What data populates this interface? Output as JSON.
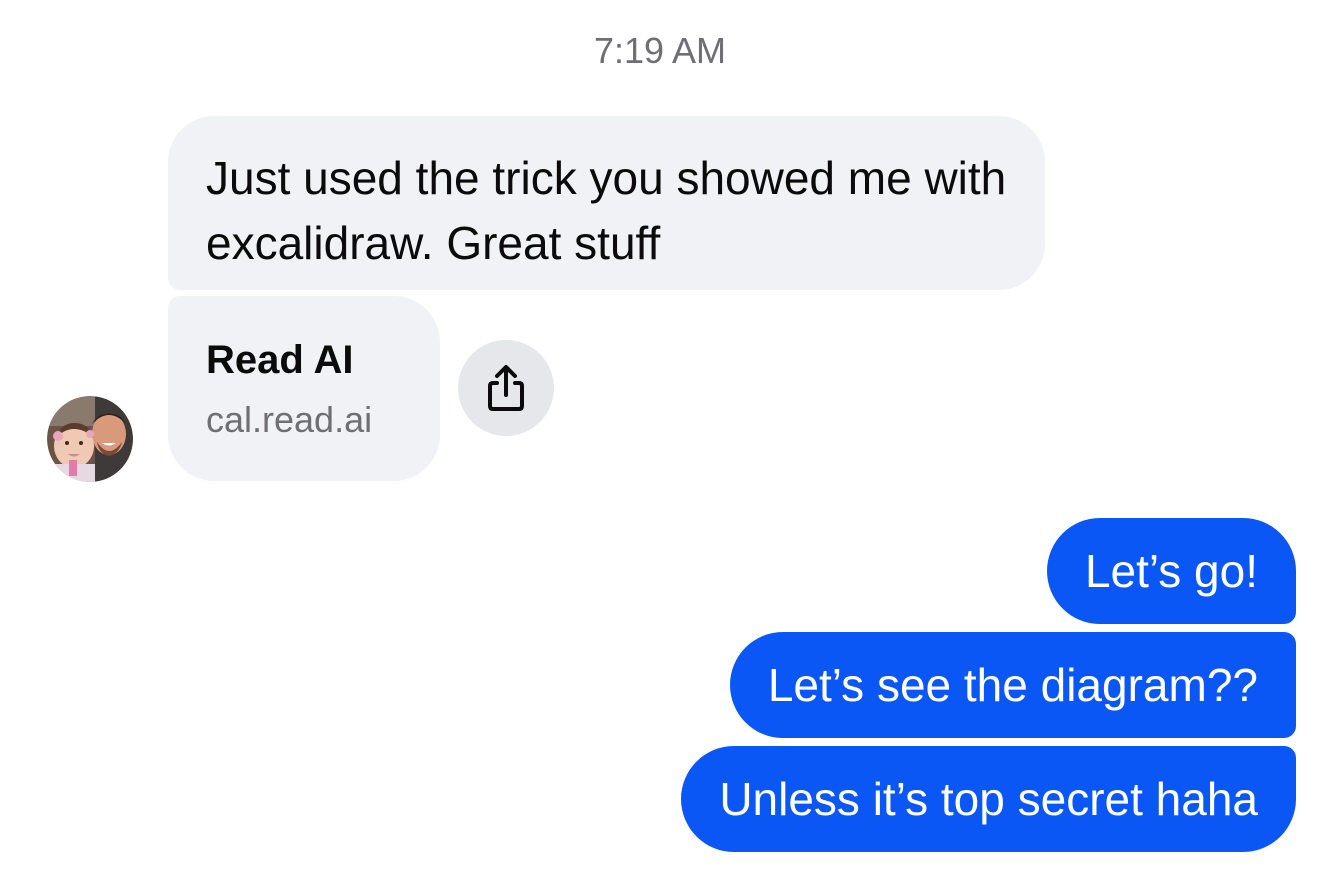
{
  "conversation": {
    "timestamp": "7:19 AM",
    "incoming": {
      "message_1": "Just used the trick you showed me with excalidraw. Great stuff",
      "link_preview": {
        "title": "Read AI",
        "domain": "cal.read.ai"
      },
      "share_icon": "share-icon",
      "avatar": "contact-avatar-photo"
    },
    "outgoing": [
      "Let’s go!",
      "Let’s see the diagram??",
      "Unless it’s top secret haha"
    ]
  },
  "colors": {
    "incoming_bubble": "#f1f2f6",
    "outgoing_bubble": "#0a57f5",
    "timestamp_text": "#6e6e73"
  }
}
